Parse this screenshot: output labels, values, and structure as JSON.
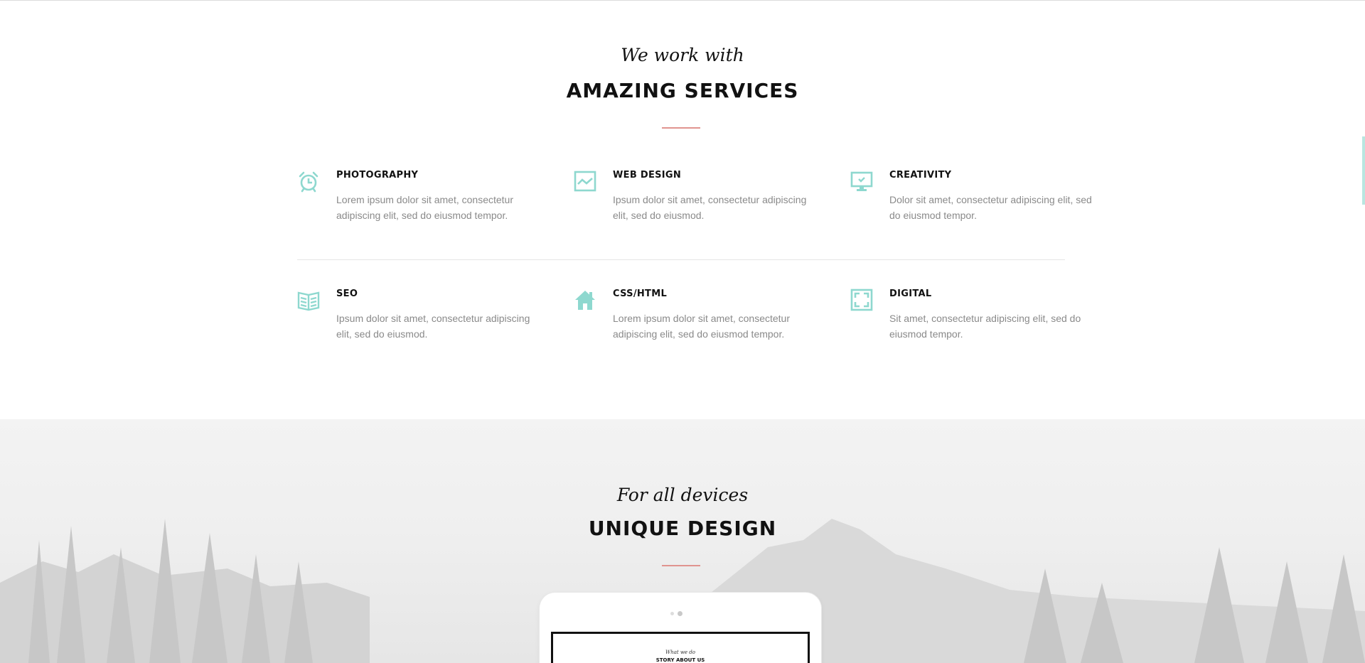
{
  "services_section": {
    "script_title": "We work with",
    "heading": "AMAZING SERVICES",
    "accent_color": "#e0948f",
    "icon_color": "#8ed8cf",
    "items": [
      {
        "icon": "alarm-clock-icon",
        "title": "PHOTOGRAPHY",
        "desc": "Lorem ipsum dolor sit amet, consectetur adipiscing elit, sed do eiusmod tempor."
      },
      {
        "icon": "chart-icon",
        "title": "WEB DESIGN",
        "desc": "Ipsum dolor sit amet, consectetur adipiscing elit, sed do eiusmod."
      },
      {
        "icon": "monitor-icon",
        "title": "CREATIVITY",
        "desc": "Dolor sit amet, consectetur adipiscing elit, sed do eiusmod tempor."
      },
      {
        "icon": "book-icon",
        "title": "SEO",
        "desc": "Ipsum dolor sit amet, consectetur adipiscing elit, sed do eiusmod."
      },
      {
        "icon": "house-icon",
        "title": "CSS/HTML",
        "desc": "Lorem ipsum dolor sit amet, consectetur adipiscing elit, sed do eiusmod tempor."
      },
      {
        "icon": "frame-icon",
        "title": "DIGITAL",
        "desc": "Sit amet, consectetur adipiscing elit, sed do eiusmod tempor."
      }
    ]
  },
  "design_section": {
    "script_title": "For all devices",
    "heading": "UNIQUE DESIGN",
    "tablet_screen": {
      "script_title": "What we do",
      "heading": "STORY ABOUT US"
    }
  }
}
